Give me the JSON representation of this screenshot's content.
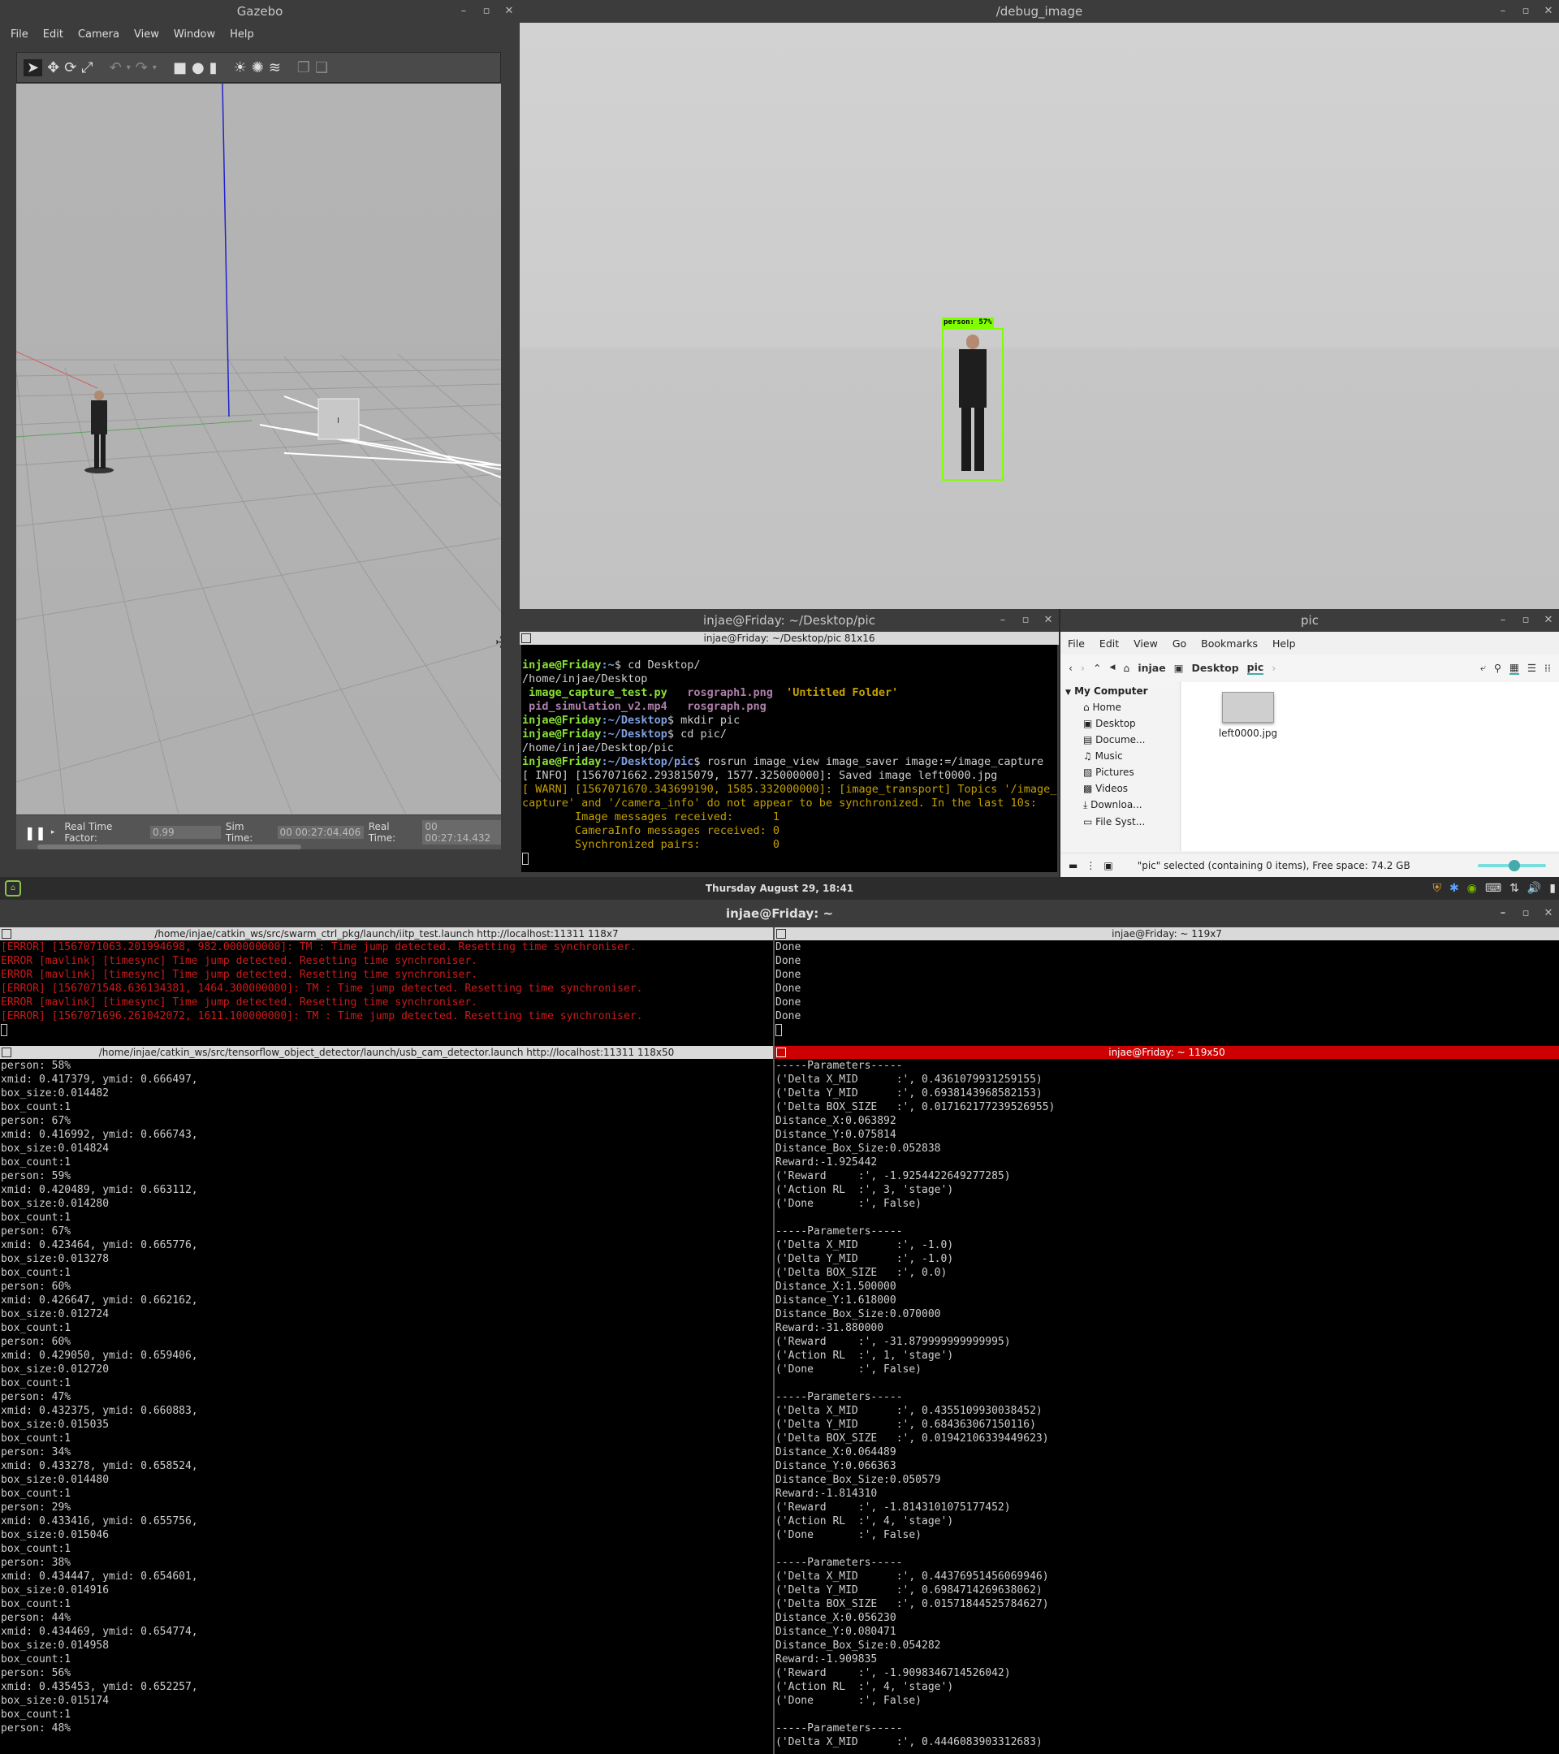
{
  "gazebo": {
    "title": "Gazebo",
    "menu": [
      "File",
      "Edit",
      "Camera",
      "View",
      "Window",
      "Help"
    ],
    "status": {
      "rtf_label": "Real Time Factor:",
      "rtf_value": "0.99",
      "sim_label": "Sim Time:",
      "sim_value": "00 00:27:04.406",
      "real_label": "Real Time:",
      "real_value": "00 00:27:14.432"
    }
  },
  "debug_image": {
    "title": "/debug_image",
    "detection_label": "person: 57%"
  },
  "terminal_small": {
    "window_title": "injae@Friday: ~/Desktop/pic",
    "tab_title": "injae@Friday: ~/Desktop/pic 81x16",
    "lines": [
      {
        "prompt": "injae@Friday",
        "path": ":~",
        "cmd": "$ cd Desktop/"
      },
      {
        "text": "/home/injae/Desktop"
      },
      {
        "ls1a": " image_capture_test.py",
        "ls1b": "rosgraph1.png",
        "ls1c": "'Untitled Folder'"
      },
      {
        "ls2a": " pid_simulation_v2.mp4",
        "ls2b": "rosgraph.png"
      },
      {
        "prompt": "injae@Friday",
        "path": ":~/Desktop",
        "cmd": "$ mkdir pic"
      },
      {
        "prompt": "injae@Friday",
        "path": ":~/Desktop",
        "cmd": "$ cd pic/"
      },
      {
        "text": "/home/injae/Desktop/pic"
      },
      {
        "prompt": "injae@Friday",
        "path": ":~/Desktop/pic",
        "cmd": "$ rosrun image_view image_saver image:=/image_capture"
      },
      {
        "text": "[ INFO] [1567071662.293815079, 1577.325000000]: Saved image left0000.jpg"
      },
      {
        "warn": "[ WARN] [1567071670.343699190, 1585.332000000]: [image_transport] Topics '/image_"
      },
      {
        "warn": "capture' and '/camera_info' do not appear to be synchronized. In the last 10s:"
      },
      {
        "warn": "        Image messages received:      1"
      },
      {
        "warn": "        CameraInfo messages received: 0"
      },
      {
        "warn": "        Synchronized pairs:           0"
      }
    ]
  },
  "file_manager": {
    "title": "pic",
    "menu": [
      "File",
      "Edit",
      "View",
      "Go",
      "Bookmarks",
      "Help"
    ],
    "breadcrumb": [
      "injae",
      "Desktop",
      "pic"
    ],
    "sidebar_header": "My Computer",
    "sidebar_items": [
      "Home",
      "Desktop",
      "Docume...",
      "Music",
      "Pictures",
      "Videos",
      "Downloa...",
      "File Syst..."
    ],
    "file_name": "left0000.jpg",
    "status": "\"pic\" selected (containing 0 items), Free space: 74.2 GB"
  },
  "taskbar": {
    "clock": "Thursday August 29, 18:41"
  },
  "bottom_terminal": {
    "window_title": "injae@Friday: ~",
    "pane_tl_title": "/home/injae/catkin_ws/src/swarm_ctrl_pkg/launch/iitp_test.launch http://localhost:11311 118x7",
    "pane_tl_lines": [
      "[ERROR] [1567071063.201994698, 982.000000000]: TM : Time jump detected. Resetting time synchroniser.",
      "ERROR [mavlink] [timesync] Time jump detected. Resetting time synchroniser.",
      "ERROR [mavlink] [timesync] Time jump detected. Resetting time synchroniser.",
      "[ERROR] [1567071548.636134381, 1464.300000000]: TM : Time jump detected. Resetting time synchroniser.",
      "ERROR [mavlink] [timesync] Time jump detected. Resetting time synchroniser.",
      "[ERROR] [1567071696.261042072, 1611.100000000]: TM : Time jump detected. Resetting time synchroniser."
    ],
    "pane_tr_title": "injae@Friday: ~ 119x7",
    "pane_tr_lines": [
      "Done",
      "Done",
      "Done",
      "Done",
      "Done",
      "Done"
    ],
    "pane_bl_title": "/home/injae/catkin_ws/src/tensorflow_object_detector/launch/usb_cam_detector.launch http://localhost:11311 118x50",
    "pane_bl_lines": [
      "person: 58%",
      "xmid: 0.417379, ymid: 0.666497,",
      "box_size:0.014482",
      "box_count:1",
      "person: 67%",
      "xmid: 0.416992, ymid: 0.666743,",
      "box_size:0.014824",
      "box_count:1",
      "person: 59%",
      "xmid: 0.420489, ymid: 0.663112,",
      "box_size:0.014280",
      "box_count:1",
      "person: 67%",
      "xmid: 0.423464, ymid: 0.665776,",
      "box_size:0.013278",
      "box_count:1",
      "person: 60%",
      "xmid: 0.426647, ymid: 0.662162,",
      "box_size:0.012724",
      "box_count:1",
      "person: 60%",
      "xmid: 0.429050, ymid: 0.659406,",
      "box_size:0.012720",
      "box_count:1",
      "person: 47%",
      "xmid: 0.432375, ymid: 0.660883,",
      "box_size:0.015035",
      "box_count:1",
      "person: 34%",
      "xmid: 0.433278, ymid: 0.658524,",
      "box_size:0.014480",
      "box_count:1",
      "person: 29%",
      "xmid: 0.433416, ymid: 0.655756,",
      "box_size:0.015046",
      "box_count:1",
      "person: 38%",
      "xmid: 0.434447, ymid: 0.654601,",
      "box_size:0.014916",
      "box_count:1",
      "person: 44%",
      "xmid: 0.434469, ymid: 0.654774,",
      "box_size:0.014958",
      "box_count:1",
      "person: 56%",
      "xmid: 0.435453, ymid: 0.652257,",
      "box_size:0.015174",
      "box_count:1",
      "person: 48%"
    ],
    "pane_br_title": "injae@Friday: ~ 119x50",
    "pane_br_lines": [
      "-----Parameters-----",
      "('Delta X_MID      :', 0.4361079931259155)",
      "('Delta Y_MID      :', 0.6938143968582153)",
      "('Delta BOX_SIZE   :', 0.017162177239526955)",
      "Distance_X:0.063892",
      "Distance_Y:0.075814",
      "Distance_Box_Size:0.052838",
      "Reward:-1.925442",
      "('Reward     :', -1.9254422649277285)",
      "('Action RL  :', 3, 'stage')",
      "('Done       :', False)",
      "",
      "-----Parameters-----",
      "('Delta X_MID      :', -1.0)",
      "('Delta Y_MID      :', -1.0)",
      "('Delta BOX_SIZE   :', 0.0)",
      "Distance_X:1.500000",
      "Distance_Y:1.618000",
      "Distance_Box_Size:0.070000",
      "Reward:-31.880000",
      "('Reward     :', -31.879999999999995)",
      "('Action RL  :', 1, 'stage')",
      "('Done       :', False)",
      "",
      "-----Parameters-----",
      "('Delta X_MID      :', 0.4355109930038452)",
      "('Delta Y_MID      :', 0.684363067150116)",
      "('Delta BOX_SIZE   :', 0.01942106339449623)",
      "Distance_X:0.064489",
      "Distance_Y:0.066363",
      "Distance_Box_Size:0.050579",
      "Reward:-1.814310",
      "('Reward     :', -1.8143101075177452)",
      "('Action RL  :', 4, 'stage')",
      "('Done       :', False)",
      "",
      "-----Parameters-----",
      "('Delta X_MID      :', 0.44376951456069946)",
      "('Delta Y_MID      :', 0.6984714269638062)",
      "('Delta BOX_SIZE   :', 0.01571844525784627)",
      "Distance_X:0.056230",
      "Distance_Y:0.080471",
      "Distance_Box_Size:0.054282",
      "Reward:-1.909835",
      "('Reward     :', -1.9098346714526042)",
      "('Action RL  :', 4, 'stage')",
      "('Done       :', False)",
      "",
      "-----Parameters-----",
      "('Delta X_MID      :', 0.4446083903312683)"
    ]
  }
}
